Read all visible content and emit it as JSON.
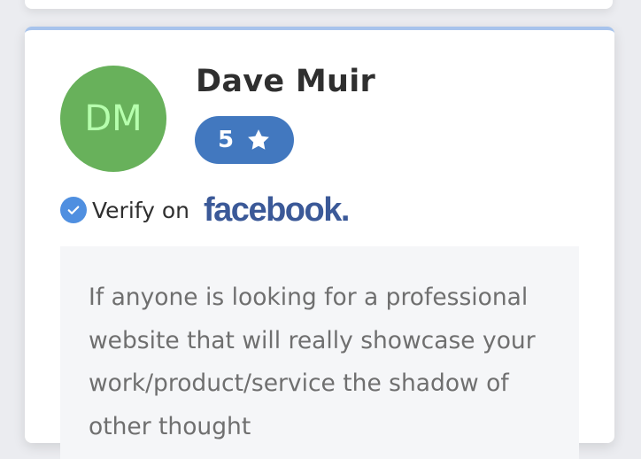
{
  "review": {
    "avatar_initials": "DM",
    "reviewer_name": "Dave Muir",
    "rating_value": "5",
    "rating_icon": "star-icon",
    "verify_label": "Verify on",
    "verify_icon": "check-circle-icon",
    "platform_logo": "facebook",
    "platform_logo_suffix": ".",
    "text": "If anyone is looking for a professional website that will really showcase your work/product/service the shadow of other thought"
  },
  "colors": {
    "avatar_bg": "#68b15b",
    "avatar_text": "#b6ffad",
    "rating_badge": "#4278bf",
    "verify_check": "#4f8fe0",
    "facebook_blue": "#3b5998",
    "card_top_border": "#a7c3ec"
  }
}
